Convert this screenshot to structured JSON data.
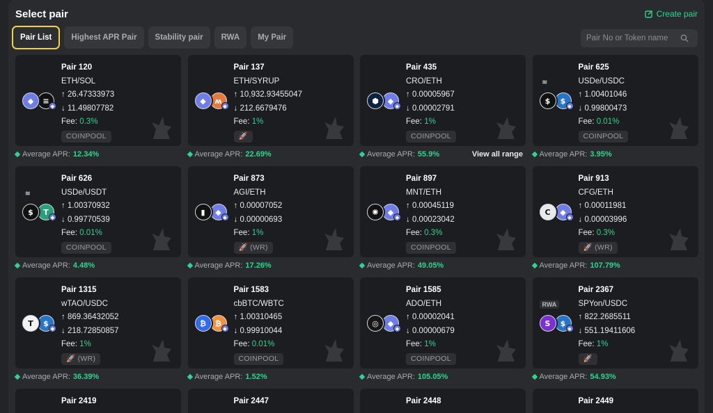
{
  "header": {
    "title": "Select pair",
    "create_label": "Create pair"
  },
  "tabs": [
    {
      "label": "Pair List",
      "active": true
    },
    {
      "label": "Highest APR Pair"
    },
    {
      "label": "Stability pair"
    },
    {
      "label": "RWA"
    },
    {
      "label": "My Pair"
    }
  ],
  "search": {
    "placeholder": "Pair No or Token name"
  },
  "apr_label": "Average APR:",
  "view_all_range": "View all range",
  "colors": {
    "accent_green": "#2bd68f",
    "active_tab_border": "#f0d43a",
    "card_bg": "#1c1d21"
  },
  "pairs": [
    {
      "name": "Pair 120",
      "tokens": "ETH/SOL",
      "up": "26.47333973",
      "down": "11.49807782",
      "fee": "0.3%",
      "badge": "COINPOOL",
      "apr": "12.34%",
      "icons": [
        "eth-icon",
        "sol-icon"
      ]
    },
    {
      "name": "Pair 137",
      "tokens": "ETH/SYRUP",
      "up": "10,932.93455047",
      "down": "212.6679476",
      "fee": "1%",
      "badge": "🚀",
      "apr": "22.69%",
      "icons": [
        "eth-icon",
        "syrup-icon"
      ]
    },
    {
      "name": "Pair 435",
      "tokens": "CRO/ETH",
      "up": "0.00005967",
      "down": "0.00002791",
      "fee": "1%",
      "badge": "COINPOOL",
      "apr": "55.9%",
      "icons": [
        "cro-icon",
        "eth-icon"
      ],
      "view_all": true
    },
    {
      "name": "Pair 625",
      "tokens": "USDe/USDC",
      "up": "1.00401046",
      "down": "0.99800473",
      "fee": "0.01%",
      "badge": "COINPOOL",
      "apr": "3.95%",
      "icons": [
        "usde-icon",
        "usdc-icon"
      ],
      "top_tag": "≋"
    },
    {
      "name": "Pair 626",
      "tokens": "USDe/USDT",
      "up": "1.00370932",
      "down": "0.99770539",
      "fee": "0.01%",
      "badge": "COINPOOL",
      "apr": "4.48%",
      "icons": [
        "usde-icon",
        "usdt-icon"
      ],
      "top_tag": "≋"
    },
    {
      "name": "Pair 873",
      "tokens": "AGI/ETH",
      "up": "0.00007052",
      "down": "0.00000693",
      "fee": "1%",
      "badge": "🚀 (WR)",
      "apr": "17.26%",
      "icons": [
        "agi-icon",
        "eth-icon"
      ]
    },
    {
      "name": "Pair 897",
      "tokens": "MNT/ETH",
      "up": "0.00045119",
      "down": "0.00023042",
      "fee": "0.3%",
      "badge": "COINPOOL",
      "apr": "49.05%",
      "icons": [
        "mnt-icon",
        "eth-icon"
      ]
    },
    {
      "name": "Pair 913",
      "tokens": "CFG/ETH",
      "up": "0.00011981",
      "down": "0.00003996",
      "fee": "0.3%",
      "badge": "🚀 (WR)",
      "apr": "107.79%",
      "icons": [
        "cfg-icon",
        "eth-icon"
      ]
    },
    {
      "name": "Pair 1315",
      "tokens": "wTAO/USDC",
      "up": "869.36432052",
      "down": "218.72850857",
      "fee": "1%",
      "badge": "🚀 (WR)",
      "apr": "36.39%",
      "icons": [
        "tao-icon",
        "usdc-icon"
      ]
    },
    {
      "name": "Pair 1583",
      "tokens": "cbBTC/WBTC",
      "up": "1.00310465",
      "down": "0.99910044",
      "fee": "0.01%",
      "badge": "COINPOOL",
      "apr": "1.52%",
      "icons": [
        "cbbtc-icon",
        "wbtc-icon"
      ]
    },
    {
      "name": "Pair 1585",
      "tokens": "ADO/ETH",
      "up": "0.00002041",
      "down": "0.00000679",
      "fee": "1%",
      "badge": "COINPOOL",
      "apr": "105.05%",
      "icons": [
        "ado-icon",
        "eth-icon"
      ]
    },
    {
      "name": "Pair 2367",
      "tokens": "SPYon/USDC",
      "up": "822.2685511",
      "down": "551.19411606",
      "fee": "1%",
      "badge": "🚀",
      "apr": "54.93%",
      "icons": [
        "spyon-icon",
        "usdc-icon"
      ],
      "top_tag": "RWA"
    }
  ],
  "partial_pairs": [
    {
      "name": "Pair 2419"
    },
    {
      "name": "Pair 2447"
    },
    {
      "name": "Pair 2448"
    },
    {
      "name": "Pair 2449"
    }
  ],
  "arrows": {
    "up": "↑",
    "down": "↓"
  },
  "fee_label": "Fee:"
}
